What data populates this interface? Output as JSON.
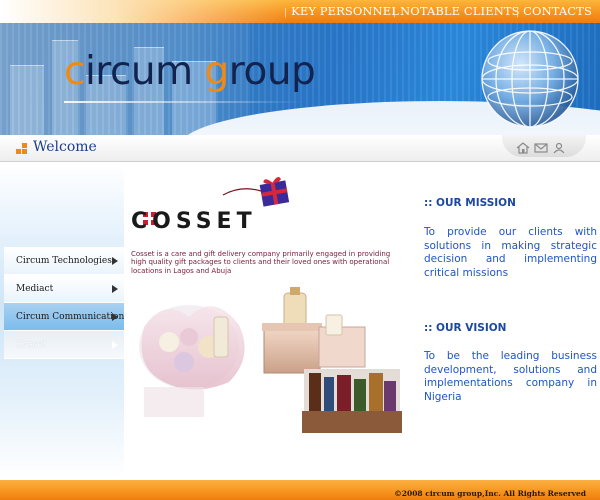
{
  "nav": {
    "items": [
      {
        "label": "KEY PERSONNEL"
      },
      {
        "label": "NOTABLE CLIENTS"
      },
      {
        "label": "CONTACTS"
      }
    ],
    "separator": "|"
  },
  "banner": {
    "logo_c": "c",
    "logo_ircum": "ircum ",
    "logo_g": "g",
    "logo_roup": "roup"
  },
  "welcome": {
    "title": "Welcome"
  },
  "sidebar": {
    "items": [
      {
        "label": "Circum Technologies"
      },
      {
        "label": "Mediact"
      },
      {
        "label": "Circum Communications"
      },
      {
        "label": "Cosset"
      }
    ]
  },
  "cosset": {
    "brand": "COSSET",
    "description": "Cosset is a care and gift delivery company primarily engaged in providing high quality gift packages to clients and their loved ones with operational locations in Lagos and Abuja"
  },
  "mission": {
    "heading": ":: OUR MISSION",
    "text": "To provide our clients with solutions in making strategic decision and implementing critical missions"
  },
  "vision": {
    "heading": ":: OUR VISION",
    "text": "To be the leading business development, solutions and implementations company in Nigeria"
  },
  "footer": {
    "copyright": "©2008 circum group,Inc. All Rights Reserved"
  },
  "colors": {
    "orange": "#f7931e",
    "navy": "#12234f",
    "heading_blue": "#1b48a0",
    "text_blue": "#1f55c4",
    "desc_maroon": "#7a1b3a"
  },
  "icons": [
    "home-icon",
    "mail-icon",
    "user-icon",
    "chevron-right-icon",
    "welcome-bullet-icon",
    "globe-graphic",
    "gift-box-icon"
  ]
}
